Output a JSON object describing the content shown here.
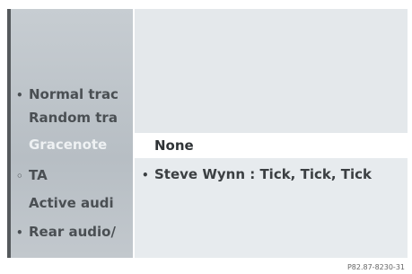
{
  "background_menu": {
    "items": [
      {
        "mark": "•",
        "label": "Normal trac",
        "dimmed": false
      },
      {
        "mark": "",
        "label": "Random tra",
        "dimmed": false
      },
      {
        "mark": "",
        "label": "Gracenote ",
        "dimmed": true
      },
      {
        "mark": "◦",
        "label": "TA",
        "dimmed": false
      },
      {
        "mark": "",
        "label": "Active audi",
        "dimmed": false
      },
      {
        "mark": "•",
        "label": "Rear audio/",
        "dimmed": false
      }
    ]
  },
  "popup_list": {
    "items": [
      {
        "mark": "",
        "label": "None",
        "highlighted": true
      },
      {
        "mark": "•",
        "label": "Steve Wynn : Tick, Tick, Tick",
        "highlighted": false
      }
    ]
  },
  "caption": "P82.87-8230-31"
}
